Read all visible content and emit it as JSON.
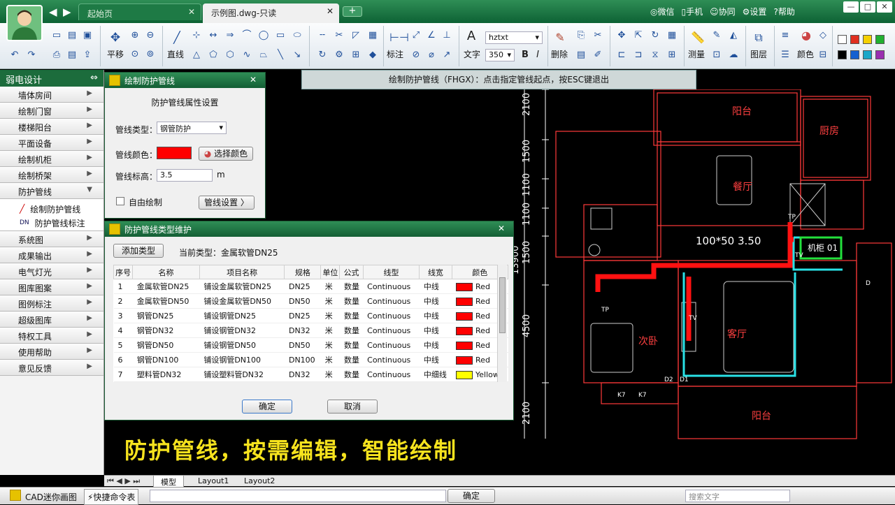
{
  "titlebar": {
    "tabs": [
      {
        "label": "起始页"
      },
      {
        "label": "示例图.dwg-只读"
      }
    ],
    "add_tab": "+",
    "links": [
      "微信",
      "手机",
      "协同",
      "设置",
      "帮助"
    ],
    "win_buttons": [
      "—",
      "□",
      "✕"
    ]
  },
  "ribbon": {
    "labels": {
      "pan": "平移",
      "line": "直线",
      "dim": "标注",
      "text": "文字",
      "delete": "删除",
      "measure": "测量",
      "layer": "图层",
      "color": "颜色"
    },
    "font_name": "hztxt",
    "font_size": "350",
    "bold": "B",
    "italic": "I",
    "palette": [
      "#ffffff",
      "#e03020",
      "#f5d000",
      "#20b030",
      "#000000",
      "#1560d0",
      "#1aa7c8",
      "#9a2fb0"
    ]
  },
  "left_panel": {
    "header": "弱电设计",
    "pin": "⇔",
    "items_top": [
      "墙体房间",
      "绘制门窗",
      "楼梯阳台",
      "平面设备",
      "绘制机柜",
      "绘制桥架"
    ],
    "expanded": "防护管线",
    "sub_items": [
      {
        "icon": "╱",
        "label": "绘制防护管线"
      },
      {
        "icon": "DN",
        "label": "防护管线标注"
      }
    ],
    "items_bottom": [
      "系统图",
      "成果输出",
      "电气灯光",
      "图库图案",
      "图例标注",
      "超级图库",
      "特权工具",
      "使用帮助",
      "意见反馈"
    ]
  },
  "command_tip": "绘制防护管线（FHGX）：点击指定管线起点，按ESC键退出",
  "draw_dialog": {
    "title": "绘制防护管线",
    "heading": "防护管线属性设置",
    "type_label": "管线类型：",
    "type_value": "钢管防护",
    "color_label": "管线颜色：",
    "color_value": "#ff0000",
    "choose_color": "选择颜色",
    "height_label": "管线标高：",
    "height_value": "3.5",
    "height_unit": "m",
    "free_draw": "自由绘制",
    "pipe_settings": "管线设置 〉"
  },
  "type_dialog": {
    "title": "防护管线类型维护",
    "add_type": "添加类型",
    "current_type": "当前类型：金属软管DN25",
    "columns": [
      "序号",
      "名称",
      "项目名称",
      "规格",
      "单位",
      "公式",
      "线型",
      "线宽",
      "颜色"
    ],
    "rows": [
      [
        "1",
        "金属软管DN25",
        "铺设金属软管DN25",
        "DN25",
        "米",
        "数量",
        "Continuous",
        "中线",
        "Red"
      ],
      [
        "2",
        "金属软管DN50",
        "铺设金属软管DN50",
        "DN50",
        "米",
        "数量",
        "Continuous",
        "中线",
        "Red"
      ],
      [
        "3",
        "钢管DN25",
        "铺设钢管DN25",
        "DN25",
        "米",
        "数量",
        "Continuous",
        "中线",
        "Red"
      ],
      [
        "4",
        "钢管DN32",
        "铺设钢管DN32",
        "DN32",
        "米",
        "数量",
        "Continuous",
        "中线",
        "Red"
      ],
      [
        "5",
        "钢管DN50",
        "铺设钢管DN50",
        "DN50",
        "米",
        "数量",
        "Continuous",
        "中线",
        "Red"
      ],
      [
        "6",
        "钢管DN100",
        "铺设钢管DN100",
        "DN100",
        "米",
        "数量",
        "Continuous",
        "中线",
        "Red"
      ],
      [
        "7",
        "塑料管DN32",
        "铺设塑料管DN32",
        "DN32",
        "米",
        "数量",
        "Continuous",
        "中细线",
        "Yellow"
      ]
    ],
    "ok": "确定",
    "cancel": "取消"
  },
  "cad": {
    "dims": [
      "2100",
      "1500",
      "1100",
      "1100",
      "1500",
      "4500",
      "2100",
      "13900"
    ],
    "rooms": [
      "阳台",
      "厨房",
      "餐厅",
      "次卧",
      "客厅",
      "阳台"
    ],
    "pipe_label": "100*50   3.50",
    "cabinet": "机柜 01",
    "small_labels": [
      "TP",
      "TP",
      "TV",
      "TV",
      "D",
      "D2",
      "D1",
      "K7",
      "K7"
    ]
  },
  "slogan": "防护管线，按需编辑，智能绘制",
  "layouts": {
    "tabs": [
      "模型",
      "Layout1",
      "Layout2"
    ]
  },
  "status": {
    "app": "CAD迷你画图",
    "quick": "⚡快捷命令表",
    "confirm": "确定",
    "search_placeholder": "搜索文字",
    "cmd_value": ""
  }
}
